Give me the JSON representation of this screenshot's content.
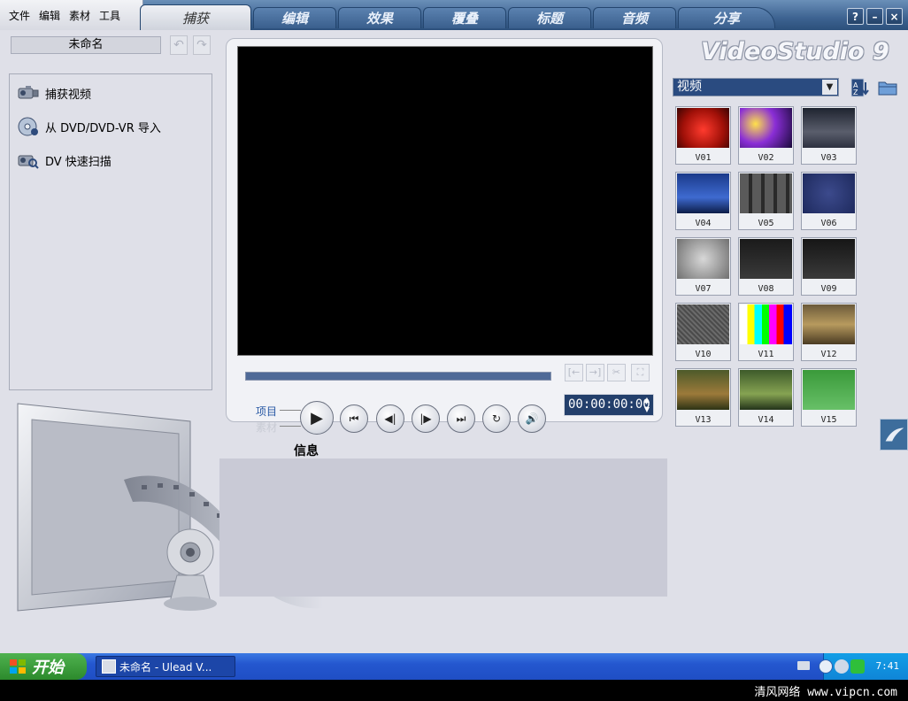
{
  "menu": [
    "文件",
    "编辑",
    "素材",
    "工具"
  ],
  "tabs": [
    "捕获",
    "编辑",
    "效果",
    "覆叠",
    "标题",
    "音频",
    "分享"
  ],
  "active_tab": "捕获",
  "window_buttons": [
    "?",
    "–",
    "×"
  ],
  "project_name": "未命名",
  "capture_options": [
    "捕获视频",
    "从 DVD/DVD-VR 导入",
    "DV 快速扫描"
  ],
  "preview": {
    "timecode": "00:00:00:00",
    "mode_project": "项目",
    "mode_clip": "素材",
    "info_label": "信息"
  },
  "library": {
    "logo": "VideoStudio 9",
    "category": "视频",
    "items": [
      "V01",
      "V02",
      "V03",
      "V04",
      "V05",
      "V06",
      "V07",
      "V08",
      "V09",
      "V10",
      "V11",
      "V12",
      "V13",
      "V14",
      "V15"
    ]
  },
  "taskbar": {
    "start_label": "开始",
    "task_label": "未命名 - Ulead V...",
    "clock": "7:41"
  },
  "watermark": "清风网络 www.vipcn.com"
}
